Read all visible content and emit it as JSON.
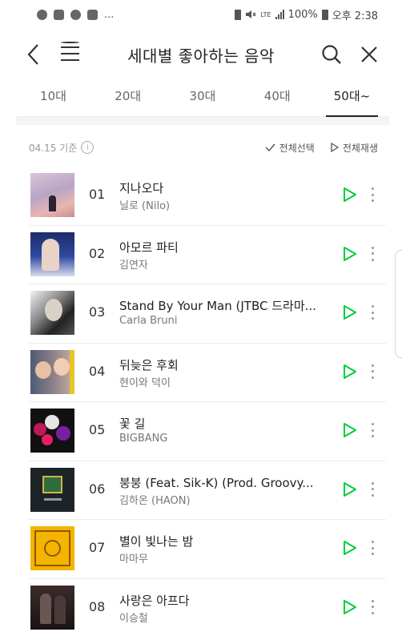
{
  "status_bar": {
    "notification_icons": [
      "app-icon",
      "gallery-icon",
      "talk-icon",
      "bag-icon"
    ],
    "more": "...",
    "lte": "LTE",
    "battery": "100%",
    "time": "오후 2:38"
  },
  "header": {
    "title": "세대별 좋아하는 음악"
  },
  "tabs": [
    {
      "label": "10대"
    },
    {
      "label": "20대"
    },
    {
      "label": "30대"
    },
    {
      "label": "40대"
    },
    {
      "label": "50대~"
    }
  ],
  "meta": {
    "date": "04.15 기준",
    "select_all": "전체선택",
    "play_all": "전체재생"
  },
  "songs": [
    {
      "rank": "01",
      "title": "지나오다",
      "artist": "닐로 (Nilo)"
    },
    {
      "rank": "02",
      "title": "아모르 파티",
      "artist": "김연자"
    },
    {
      "rank": "03",
      "title": "Stand By Your Man (JTBC 드라마...",
      "artist": "Carla Bruni"
    },
    {
      "rank": "04",
      "title": "뒤늦은 후회",
      "artist": "현이와 덕이"
    },
    {
      "rank": "05",
      "title": "꽃 길",
      "artist": "BIGBANG"
    },
    {
      "rank": "06",
      "title": "붕붕 (Feat. Sik-K) (Prod. Groovy...",
      "artist": "김하온 (HAON)"
    },
    {
      "rank": "07",
      "title": "별이 빛나는 밤",
      "artist": "마마무"
    },
    {
      "rank": "08",
      "title": "사랑은 아프다",
      "artist": "이승철"
    }
  ],
  "colors": {
    "accent": "#00cd3c",
    "text": "#222222",
    "muted": "#777777",
    "divider": "#ececec"
  }
}
